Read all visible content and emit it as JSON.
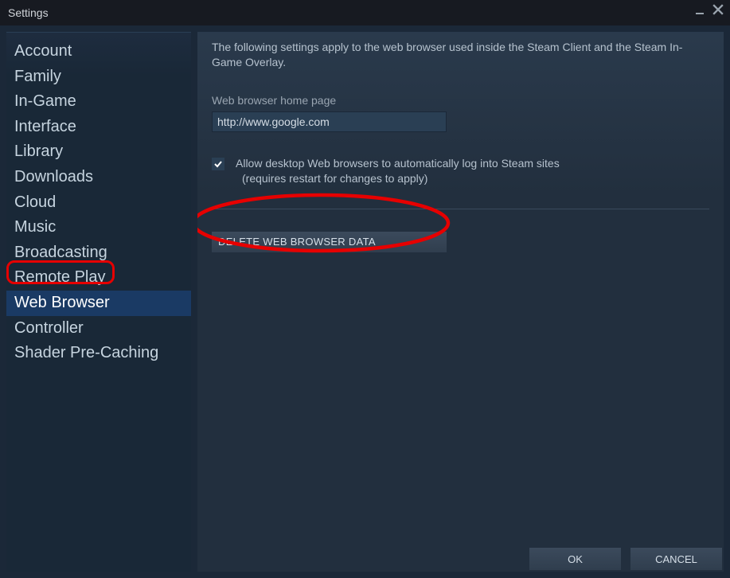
{
  "window": {
    "title": "Settings"
  },
  "sidebar": {
    "items": [
      {
        "label": "Account"
      },
      {
        "label": "Family"
      },
      {
        "label": "In-Game"
      },
      {
        "label": "Interface"
      },
      {
        "label": "Library"
      },
      {
        "label": "Downloads"
      },
      {
        "label": "Cloud"
      },
      {
        "label": "Music"
      },
      {
        "label": "Broadcasting"
      },
      {
        "label": "Remote Play"
      },
      {
        "label": "Web Browser"
      },
      {
        "label": "Controller"
      },
      {
        "label": "Shader Pre-Caching"
      }
    ],
    "active_index": 10
  },
  "content": {
    "description": "The following settings apply to the web browser used inside the Steam Client and the Steam In-Game Overlay.",
    "homepage_label": "Web browser home page",
    "homepage_value": "http://www.google.com",
    "auto_login_label": "Allow desktop Web browsers to automatically log into Steam sites",
    "auto_login_sub": "(requires restart for changes to apply)",
    "auto_login_checked": true,
    "delete_button": "DELETE WEB BROWSER DATA"
  },
  "footer": {
    "ok": "OK",
    "cancel": "CANCEL"
  },
  "annotations": {
    "sidebar_highlight": true,
    "delete_highlight": true
  }
}
